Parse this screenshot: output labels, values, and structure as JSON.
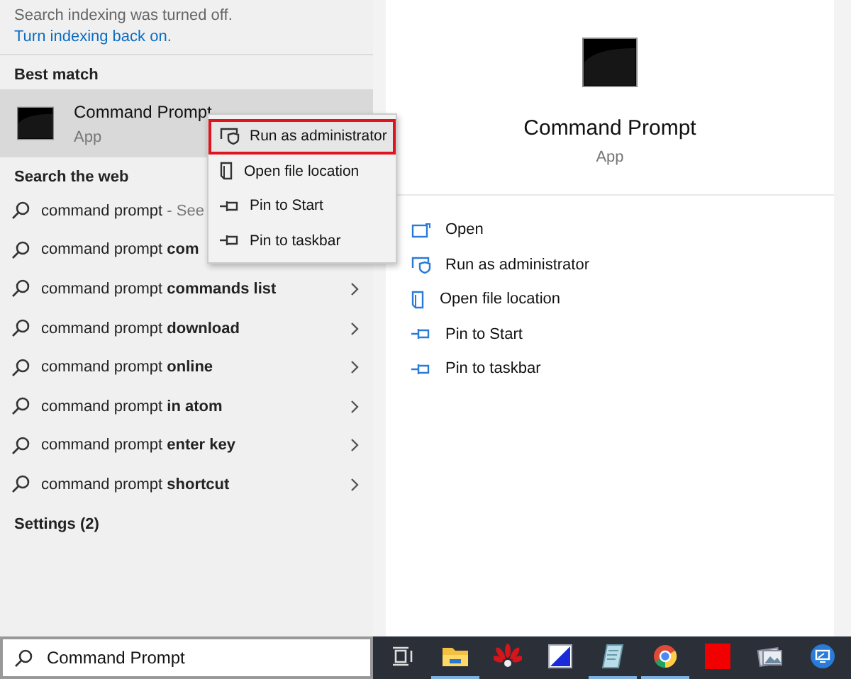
{
  "notice": {
    "text": "Search indexing was turned off.",
    "link": "Turn indexing back on."
  },
  "best_match": {
    "heading": "Best match",
    "title": "Command Prompt",
    "subtitle": "App",
    "selected": true
  },
  "context_menu": {
    "items": [
      {
        "kind": "shield",
        "label": "Run as administrator",
        "highlighted": true
      },
      {
        "kind": "folder",
        "label": "Open file location",
        "highlighted": false
      },
      {
        "kind": "pin",
        "label": "Pin to Start",
        "highlighted": false
      },
      {
        "kind": "pin",
        "label": "Pin to taskbar",
        "highlighted": false
      }
    ]
  },
  "web": {
    "heading": "Search the web",
    "results": [
      {
        "text": "command prompt",
        "suffix": "- See"
      },
      {
        "text": "command prompt **com**"
      },
      {
        "text": "command prompt **commands list**",
        "arrow": true
      },
      {
        "text": "command prompt **download**",
        "arrow": true
      },
      {
        "text": "command prompt **online**",
        "arrow": true
      },
      {
        "text": "command prompt **in atom**",
        "arrow": true
      },
      {
        "text": "command prompt **enter key**",
        "arrow": true
      },
      {
        "text": "command prompt **shortcut**",
        "arrow": true
      }
    ]
  },
  "settings": {
    "heading": "Settings (2)"
  },
  "preview": {
    "title": "Command Prompt",
    "subtitle": "App",
    "actions": [
      {
        "kind": "open",
        "label": "Open"
      },
      {
        "kind": "shield",
        "label": "Run as administrator"
      },
      {
        "kind": "folder",
        "label": "Open file location"
      },
      {
        "kind": "pin",
        "label": "Pin to Start"
      },
      {
        "kind": "pin",
        "label": "Pin to taskbar"
      }
    ]
  },
  "search_box": {
    "value": "Command Prompt"
  },
  "taskbar": [
    {
      "kind": "taskview",
      "running": false
    },
    {
      "kind": "folder",
      "running": true
    },
    {
      "kind": "flower",
      "running": false
    },
    {
      "kind": "square",
      "running": false
    },
    {
      "kind": "notepad",
      "running": true
    },
    {
      "kind": "chrome",
      "running": true
    },
    {
      "kind": "red",
      "running": false
    },
    {
      "kind": "photos",
      "running": false
    },
    {
      "kind": "remote",
      "running": false
    }
  ]
}
